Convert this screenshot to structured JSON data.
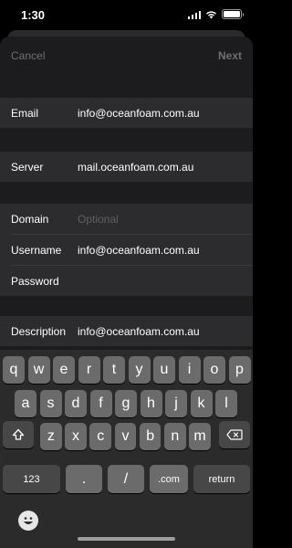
{
  "status": {
    "time": "1:30"
  },
  "nav": {
    "cancel": "Cancel",
    "next": "Next"
  },
  "form": {
    "email": {
      "label": "Email",
      "value": "info@oceanfoam.com.au"
    },
    "server": {
      "label": "Server",
      "value": "mail.oceanfoam.com.au"
    },
    "domain": {
      "label": "Domain",
      "placeholder": "Optional"
    },
    "username": {
      "label": "Username",
      "value": "info@oceanfoam.com.au"
    },
    "password": {
      "label": "Password"
    },
    "description": {
      "label": "Description",
      "value": "info@oceanfoam.com.au"
    }
  },
  "keyboard": {
    "row1": [
      "q",
      "w",
      "e",
      "r",
      "t",
      "y",
      "u",
      "i",
      "o",
      "p"
    ],
    "row2": [
      "a",
      "s",
      "d",
      "f",
      "g",
      "h",
      "j",
      "k",
      "l"
    ],
    "row3": [
      "z",
      "x",
      "c",
      "v",
      "b",
      "n",
      "m"
    ],
    "numbers": "123",
    "dot": ".",
    "slash": "/",
    "dotcom": ".com",
    "return": "return",
    "shift_icon": "shift-icon",
    "delete_icon": "delete-icon",
    "emoji_icon": "emoji-icon"
  }
}
